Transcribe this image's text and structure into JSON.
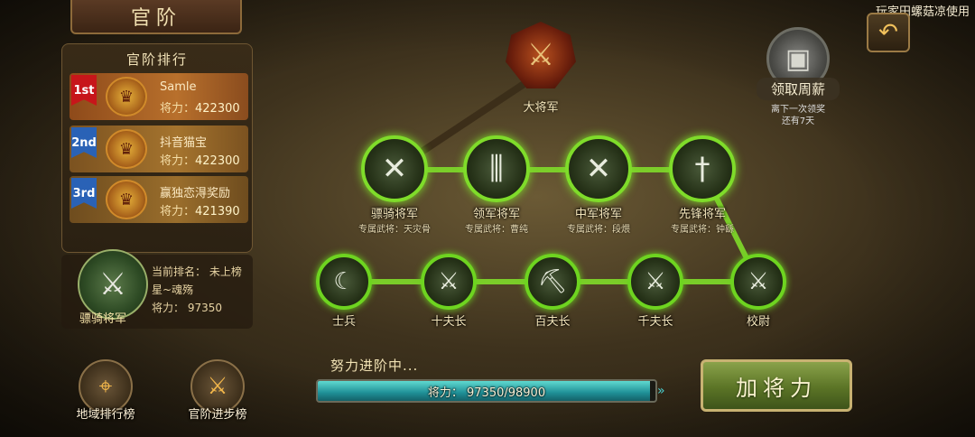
{
  "header": {
    "title": "官阶",
    "player_tag": "玩家田螺菇凉使用",
    "back_icon": "undo-arrow-icon"
  },
  "weekly_reward": {
    "label": "领取周薪",
    "hint_line1": "离下一次领奖",
    "hint_line2": "还有7天",
    "icon": "treasure-chest-icon"
  },
  "ranking": {
    "title": "官阶排行",
    "items": [
      {
        "rank": "1st",
        "name": "Samle",
        "power_label": "将力：",
        "power": "422300"
      },
      {
        "rank": "2nd",
        "name": "抖音猫宝",
        "power_label": "将力：",
        "power": "422300"
      },
      {
        "rank": "3rd",
        "name": "赢独恋淂奖励",
        "power_label": "将力：",
        "power": "421390"
      }
    ]
  },
  "my_rank": {
    "emblem_label": "骠骑将军",
    "current_rank": "当前排名：  未上榜",
    "player_name": "星~魂殇",
    "power": "将力：  97350"
  },
  "bottom_buttons": {
    "region_rank": "地域排行榜",
    "rank_progress": "官阶进步榜"
  },
  "tree": {
    "top": {
      "name": "大将军"
    },
    "generals": [
      {
        "name": "骠骑将军",
        "sub": "专属武将：天灾骨"
      },
      {
        "name": "领军将军",
        "sub": "专属武将：曹纯"
      },
      {
        "name": "中军将军",
        "sub": "专属武将：段煨"
      },
      {
        "name": "先锋将军",
        "sub": "专属武将：钟繇"
      }
    ],
    "ranks": [
      {
        "name": "士兵"
      },
      {
        "name": "十夫长"
      },
      {
        "name": "百夫长"
      },
      {
        "name": "千夫长"
      },
      {
        "name": "校尉"
      }
    ]
  },
  "progress": {
    "title": "努力进阶中...",
    "text": "将力：  97350/98900",
    "current": 97350,
    "target": 98900
  },
  "add_button": "加将力",
  "colors": {
    "path_green": "#7fdc2a",
    "progress_teal": "#2fb3b4",
    "rank1_red": "#c7161a",
    "rank_blue": "#2a62b6"
  }
}
